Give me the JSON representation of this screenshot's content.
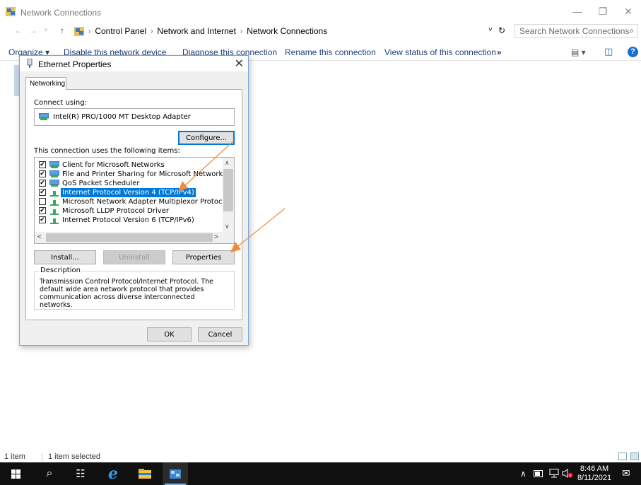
{
  "window": {
    "title": "Network Connections",
    "minimize": "—",
    "restore": "❐",
    "close": "✕"
  },
  "nav": {
    "back": "←",
    "forward": "→",
    "recent": "˅",
    "up": "↑",
    "breadcrumb": [
      "Control Panel",
      "Network and Internet",
      "Network Connections"
    ],
    "crumb_sep": "›",
    "dropdown": "˅",
    "refresh": "↻",
    "search_placeholder": "Search Network Connections",
    "search_icon": "⌕"
  },
  "commands": {
    "organize": "Organize ▾",
    "disable": "Disable this network device",
    "diagnose": "Diagnose this connection",
    "rename": "Rename this connection",
    "view_status": "View status of this connection",
    "more": "»",
    "view_icon": "▤ ▾",
    "pane_icon": "◫",
    "help_icon": "?"
  },
  "dialog": {
    "title": "Ethernet Properties",
    "close": "✕",
    "tab": "Networking",
    "connect_using_label": "Connect using:",
    "adapter": "Intel(R) PRO/1000 MT Desktop Adapter",
    "configure_button": "Configure...",
    "items_label": "This connection uses the following items:",
    "items": [
      {
        "label": "Client for Microsoft Networks",
        "checked": true,
        "selected": false,
        "icon": "network-client-icon"
      },
      {
        "label": "File and Printer Sharing for Microsoft Networks",
        "checked": true,
        "selected": false,
        "icon": "network-service-icon"
      },
      {
        "label": "QoS Packet Scheduler",
        "checked": true,
        "selected": false,
        "icon": "network-service-icon"
      },
      {
        "label": "Internet Protocol Version 4 (TCP/IPv4)",
        "checked": true,
        "selected": true,
        "icon": "protocol-icon"
      },
      {
        "label": "Microsoft Network Adapter Multiplexor Protocol",
        "checked": false,
        "selected": false,
        "icon": "protocol-icon"
      },
      {
        "label": "Microsoft LLDP Protocol Driver",
        "checked": true,
        "selected": false,
        "icon": "protocol-icon"
      },
      {
        "label": "Internet Protocol Version 6 (TCP/IPv6)",
        "checked": true,
        "selected": false,
        "icon": "protocol-icon"
      }
    ],
    "check_mark": "✔",
    "scroll_up": "∧",
    "scroll_down": "∨",
    "scroll_left": "<",
    "scroll_right": ">",
    "install_button": "Install...",
    "uninstall_button": "Uninstall",
    "properties_button": "Properties",
    "description_label": "Description",
    "description_text": "Transmission Control Protocol/Internet Protocol. The default wide area network protocol that provides communication across diverse interconnected networks.",
    "ok_button": "OK",
    "cancel_button": "Cancel"
  },
  "status": {
    "item_count": "1 item",
    "selected_count": "1 item selected"
  },
  "taskbar": {
    "start_icon": "windows-logo-icon",
    "search_glyph": "⌕",
    "task_view_glyph": "☷",
    "time": "8:46 AM",
    "date": "8/11/2021",
    "tray_chevron": "∧",
    "notification_glyph": "✉"
  },
  "colors": {
    "accent": "#0078d7",
    "annotation_arrow": "#f08a3c",
    "link_text": "#1e3f78",
    "taskbar": "#101010"
  }
}
